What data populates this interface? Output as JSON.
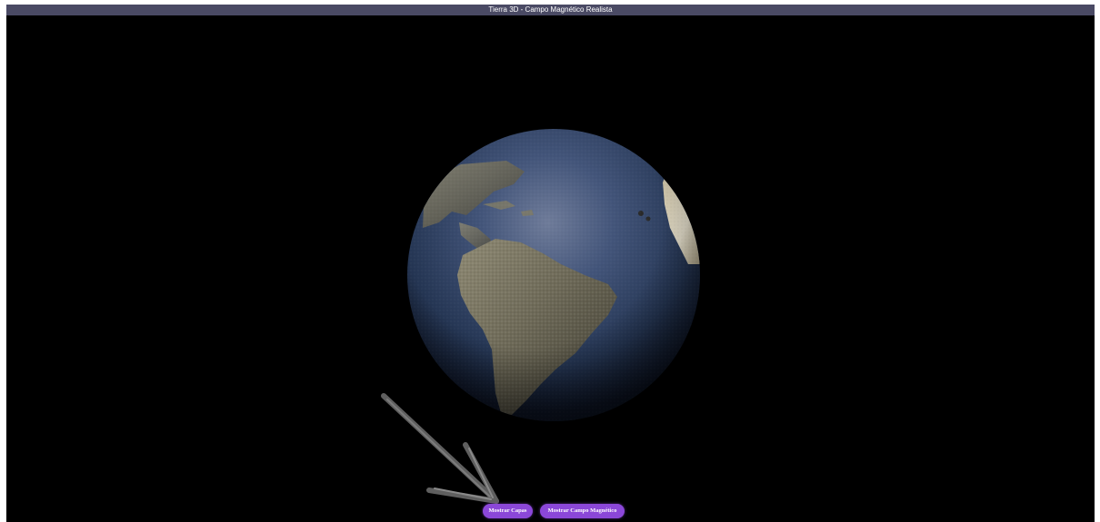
{
  "window": {
    "title": "Tierra 3D - Campo Magnético Realista"
  },
  "controls": {
    "show_layers_label": "Mostrar Capas",
    "show_field_label": "Mostrar Campo Magnético"
  },
  "colors": {
    "title_bar": "#4a4a64",
    "background": "#000000",
    "button": "#8b47d8",
    "ocean": "#2c3f5c"
  },
  "icons": {
    "globe": "earth-globe",
    "annotation": "arrow-pointer"
  }
}
